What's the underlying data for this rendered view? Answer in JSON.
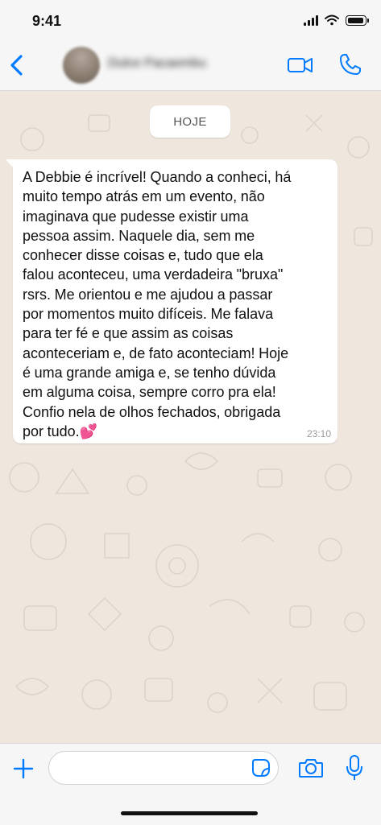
{
  "status_bar": {
    "time": "9:41"
  },
  "header": {
    "contact_name": "Dulce Pacaembu",
    "icons": [
      "chevron-left-icon",
      "video-camera-icon",
      "phone-icon"
    ]
  },
  "chat": {
    "date_label": "HOJE",
    "message": {
      "text": "A Debbie é incrível! Quando a conheci, há\nmuito tempo atrás em um evento, não\nimaginava que pudesse existir uma\npessoa assim. Naquele dia, sem me\nconhecer disse coisas e, tudo que ela\nfalou aconteceu, uma verdadeira \"bruxa\"\nrsrs. Me orientou e me ajudou a passar\npor momentos muito difíceis. Me falava\npara ter fé e que assim as coisas\naconteceriam e, de fato aconteciam! Hoje\né uma grande amiga e, se tenho dúvida\nem alguma coisa, sempre corro pra ela!\nConfio nela de olhos fechados, obrigada\npor tudo.💕",
      "time": "23:10"
    }
  },
  "composer": {
    "input_value": "",
    "icons": [
      "plus-icon",
      "sticker-icon",
      "camera-icon",
      "microphone-icon"
    ]
  },
  "colors": {
    "accent": "#007aff",
    "chat_background": "#efe7de",
    "bubble": "#ffffff",
    "bar_background": "#f6f6f6"
  }
}
